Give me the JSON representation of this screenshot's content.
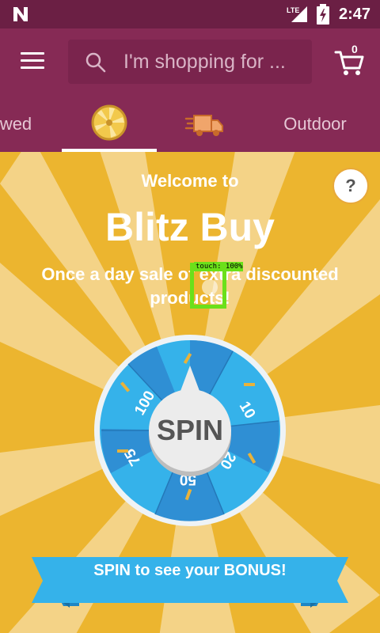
{
  "status_bar": {
    "network": "LTE",
    "time": "2:47"
  },
  "toolbar": {
    "search_placeholder": "I'm shopping for ...",
    "cart_count": "0"
  },
  "tabs": [
    {
      "label": "wed",
      "type": "text"
    },
    {
      "label": "",
      "type": "icon",
      "icon": "blitz-wheel-icon",
      "active": true
    },
    {
      "label": "",
      "type": "icon",
      "icon": "fast-delivery-icon"
    },
    {
      "label": "Outdoor",
      "type": "text"
    }
  ],
  "content": {
    "welcome": "Welcome to",
    "title": "Blitz Buy",
    "subtitle": "Once a day sale of extra discounted products!",
    "help": "?",
    "touch_label": "touch: 100%"
  },
  "wheel": {
    "center_label": "SPIN",
    "segments": [
      "10",
      "20",
      "50",
      "75",
      "100"
    ]
  },
  "banner": {
    "text": "SPIN to see your BONUS!"
  },
  "colors": {
    "status_bar": "#6b1f44",
    "toolbar": "#862a55",
    "background": "#ecb52f",
    "ray_light": "#f4d387",
    "wheel_dark": "#2f8fd4",
    "wheel_light": "#35b2ea",
    "banner": "#35b2ea"
  }
}
